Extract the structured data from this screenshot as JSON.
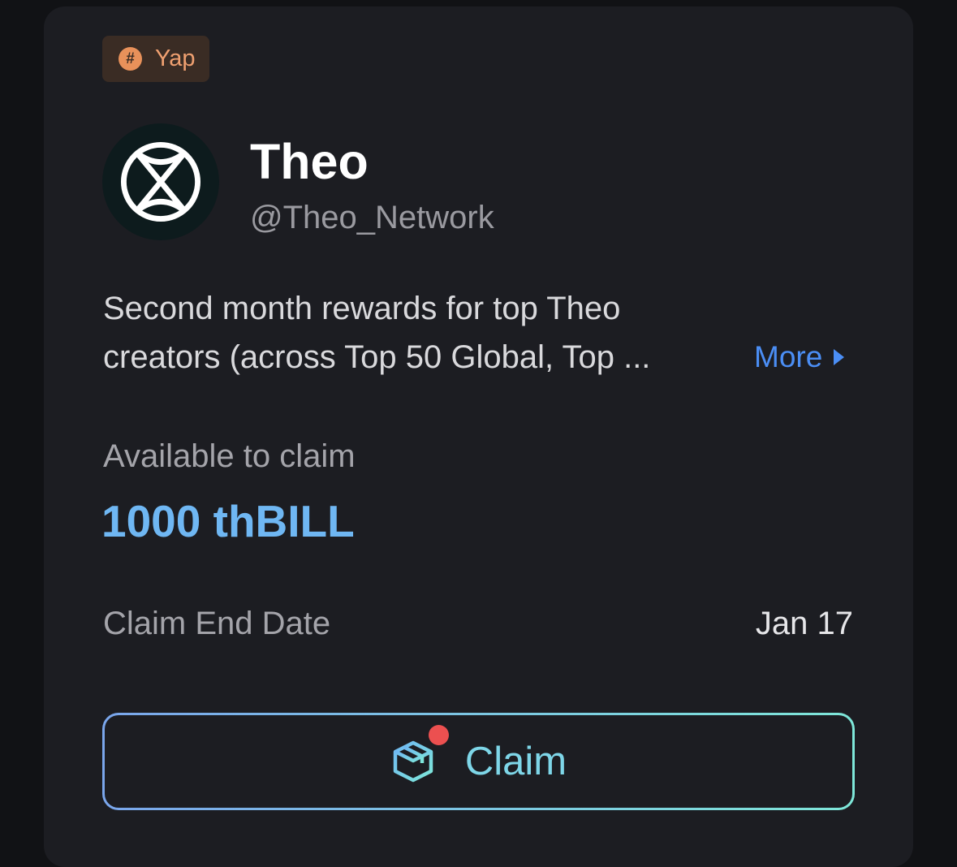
{
  "badge": {
    "label": "Yap",
    "icon": "hashtag-icon",
    "color": "#efa070"
  },
  "project": {
    "name": "Theo",
    "handle": "@Theo_Network",
    "avatar_icon": "theo-logo"
  },
  "description": {
    "line1": "Second month rewards for top Theo",
    "line2": "creators (across Top 50 Global, Top ...",
    "more_label": "More"
  },
  "claim": {
    "available_label": "Available to claim",
    "amount": "1000 thBILL",
    "end_date_label": "Claim End Date",
    "end_date_value": "Jan 17",
    "button_label": "Claim",
    "button_icon": "package-box-icon",
    "notification_color": "#ec5050"
  },
  "colors": {
    "accent_blue": "#4b8ef5",
    "amount_blue": "#6fb7f3",
    "card_bg": "#1c1d22"
  }
}
